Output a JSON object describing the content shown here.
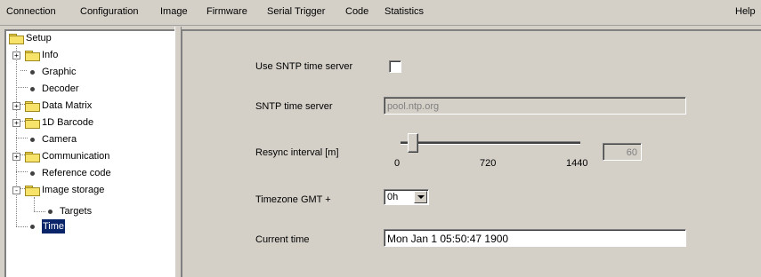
{
  "menubar": {
    "items": [
      "Connection",
      "Configuration",
      "Image",
      "Firmware",
      "Serial Trigger",
      "Code",
      "Statistics"
    ],
    "help": "Help"
  },
  "tree": {
    "root": "Setup",
    "items": [
      {
        "label": "Info",
        "type": "folder",
        "expander": "+"
      },
      {
        "label": "Graphic",
        "type": "leaf"
      },
      {
        "label": "Decoder",
        "type": "leaf"
      },
      {
        "label": "Data Matrix",
        "type": "folder",
        "expander": "+"
      },
      {
        "label": "1D Barcode",
        "type": "folder",
        "expander": "+"
      },
      {
        "label": "Camera",
        "type": "leaf"
      },
      {
        "label": "Communication",
        "type": "folder",
        "expander": "+"
      },
      {
        "label": "Reference code",
        "type": "leaf"
      },
      {
        "label": "Image storage",
        "type": "folder",
        "expander": "-"
      },
      {
        "label": "Targets",
        "type": "leaf"
      },
      {
        "label": "Time",
        "type": "leaf",
        "selected": true
      }
    ]
  },
  "form": {
    "use_sntp_label": "Use SNTP time server",
    "use_sntp_checked": false,
    "sntp_server_label": "SNTP time server",
    "sntp_server_value": "pool.ntp.org",
    "resync_label": "Resync interval [m]",
    "resync_min": "0",
    "resync_mid": "720",
    "resync_max": "1440",
    "resync_value": "60",
    "resync_fraction": 0.04,
    "timezone_label": "Timezone GMT +",
    "timezone_value": "0h",
    "current_time_label": "Current time",
    "current_time_value": "Mon Jan  1 05:50:47 1900"
  }
}
